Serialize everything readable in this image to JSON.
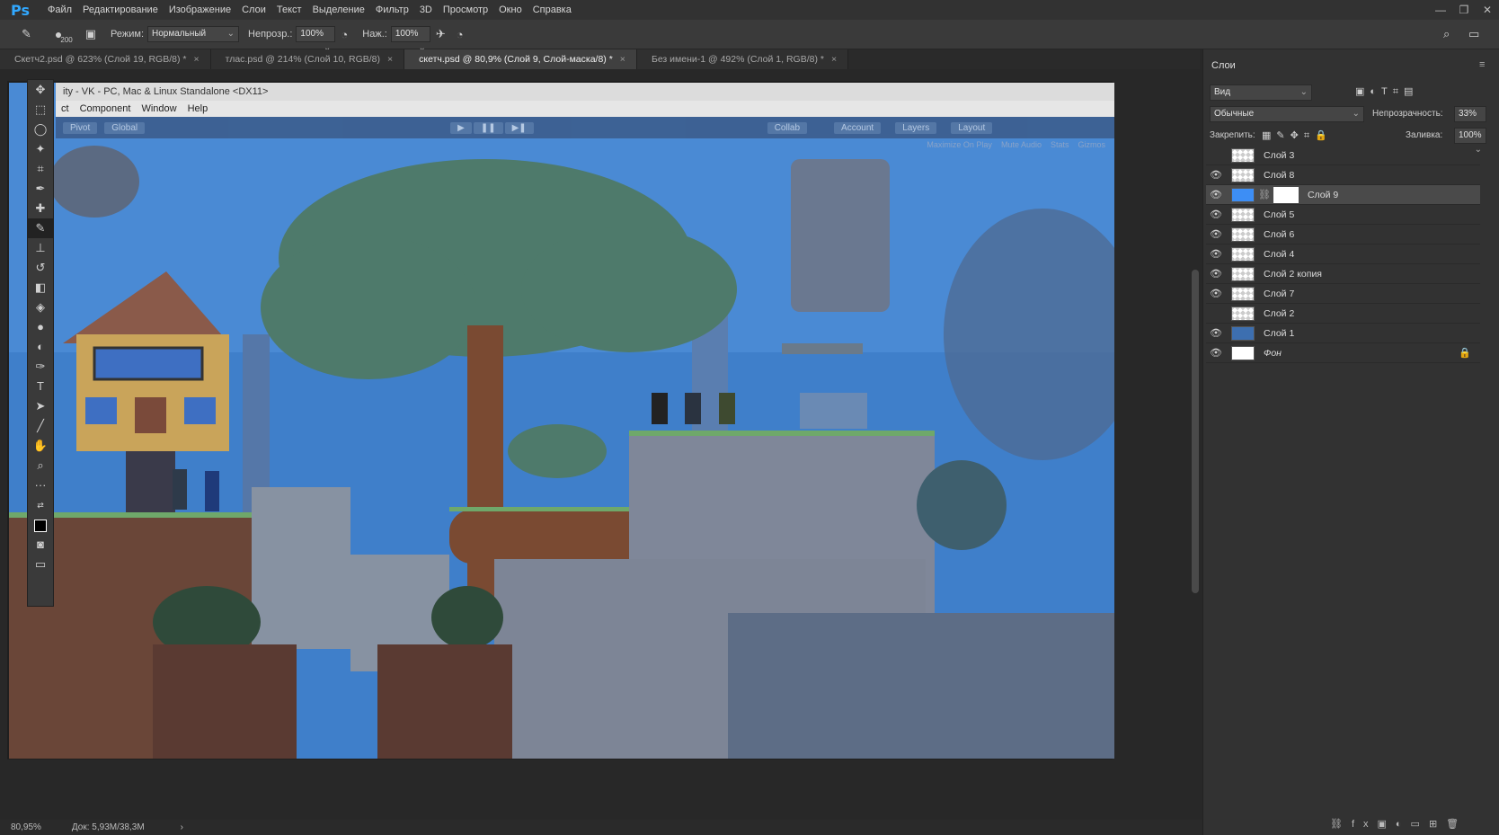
{
  "app": {
    "logo": "Ps",
    "menu": [
      "Файл",
      "Редактирование",
      "Изображение",
      "Слои",
      "Текст",
      "Выделение",
      "Фильтр",
      "3D",
      "Просмотр",
      "Окно",
      "Справка"
    ],
    "window_controls": [
      "—",
      "❐",
      "✕"
    ]
  },
  "options": {
    "brush_size": "200",
    "mode_label": "Режим:",
    "mode_value": "Нормальный",
    "opacity_label": "Непрозр.:",
    "opacity_value": "100%",
    "pressure_label": "Наж.:",
    "pressure_value": "100%"
  },
  "tabs": [
    {
      "label": "Скетч2.psd @ 623% (Слой 19, RGB/8) *",
      "active": false
    },
    {
      "label": "тлас.psd @ 214% (Слой 10, RGB/8)",
      "active": false
    },
    {
      "label": "скетч.psd @ 80,9% (Слой 9, Слой-маска/8) *",
      "active": true
    },
    {
      "label": "Без имени-1 @ 492% (Слой 1, RGB/8) *",
      "active": false
    }
  ],
  "tab_close": "×",
  "unity": {
    "title": "ity - VK - PC, Mac & Linux Standalone <DX11>",
    "menu": [
      "ct",
      "Component",
      "Window",
      "Help"
    ],
    "toolbar": [
      "Pivot",
      "Global",
      "Collab",
      "Account",
      "Layers",
      "Layout"
    ],
    "gamebar": [
      "Maximize On Play",
      "Mute Audio",
      "Stats",
      "Gizmos"
    ]
  },
  "layers_panel": {
    "title": "Слои",
    "filter_value": "Вид",
    "blend_value": "Обычные",
    "opacity_label": "Непрозрачность:",
    "opacity_value": "33%",
    "lock_label": "Закрепить:",
    "fill_label": "Заливка:",
    "fill_value": "100%",
    "layers": [
      {
        "name": "Слой 3",
        "visible": false,
        "selected": false
      },
      {
        "name": "Слой 8",
        "visible": true,
        "selected": false
      },
      {
        "name": "Слой 9",
        "visible": true,
        "selected": true
      },
      {
        "name": "Слой 5",
        "visible": true,
        "selected": false
      },
      {
        "name": "Слой 6",
        "visible": true,
        "selected": false
      },
      {
        "name": "Слой 4",
        "visible": true,
        "selected": false
      },
      {
        "name": "Слой 2 копия",
        "visible": true,
        "selected": false
      },
      {
        "name": "Слой 7",
        "visible": true,
        "selected": false
      },
      {
        "name": "Слой 2",
        "visible": false,
        "selected": false
      },
      {
        "name": "Слой 1",
        "visible": true,
        "selected": false
      },
      {
        "name": "Фон",
        "visible": true,
        "selected": false
      }
    ]
  },
  "status": {
    "zoom": "80,95%",
    "doc": "Док: 5,93M/38,3M"
  },
  "colors": {
    "sky": "#3d7ec9",
    "accent": "#31a8ff"
  }
}
